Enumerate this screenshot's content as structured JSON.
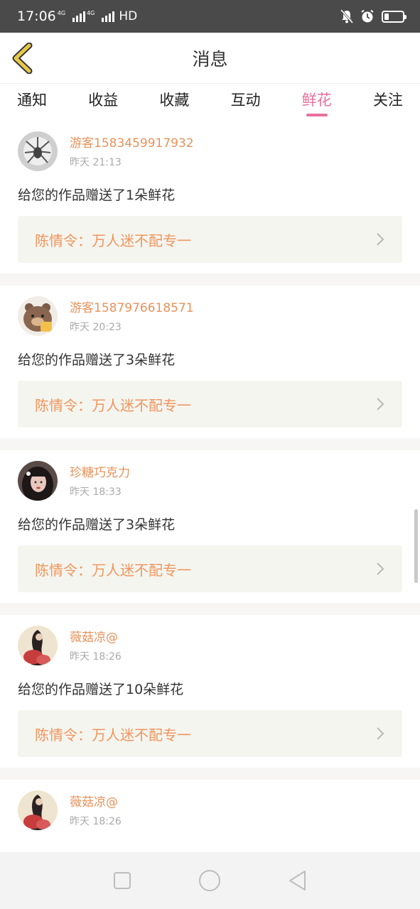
{
  "status_bar": {
    "time": "17:06",
    "network_1": "4G",
    "network_2": "4G",
    "hd_label": "HD",
    "icons": [
      "mute-icon",
      "alarm-icon",
      "battery-icon"
    ]
  },
  "header": {
    "title": "消息",
    "back_icon": "chevron-left-icon"
  },
  "tabs": [
    {
      "label": "通知",
      "active": false
    },
    {
      "label": "收益",
      "active": false
    },
    {
      "label": "收藏",
      "active": false
    },
    {
      "label": "互动",
      "active": false
    },
    {
      "label": "鲜花",
      "active": true
    },
    {
      "label": "关注",
      "active": false
    }
  ],
  "notifications": [
    {
      "username": "游客1583459917932",
      "time": "昨天 21:13",
      "message": "给您的作品赠送了1朵鲜花",
      "work": "陈情令：万人迷不配专一"
    },
    {
      "username": "游客1587976618571",
      "time": "昨天 20:23",
      "message": "给您的作品赠送了3朵鲜花",
      "work": "陈情令：万人迷不配专一"
    },
    {
      "username": "珍糖巧克力",
      "time": "昨天 18:33",
      "message": "给您的作品赠送了3朵鲜花",
      "work": "陈情令：万人迷不配专一"
    },
    {
      "username": "薇菇凉@",
      "time": "昨天 18:26",
      "message": "给您的作品赠送了10朵鲜花",
      "work": "陈情令：万人迷不配专一"
    },
    {
      "username": "薇菇凉@",
      "time": "昨天 18:26",
      "message": "",
      "work": ""
    }
  ],
  "colors": {
    "accent_pink": "#e8709e",
    "username_orange": "#e8925a",
    "work_orange": "#f0955d",
    "back_arrow_yellow": "#e6c84a"
  },
  "nav_bar": {
    "icons": [
      "recent-apps-icon",
      "home-icon",
      "back-triangle-icon"
    ]
  }
}
